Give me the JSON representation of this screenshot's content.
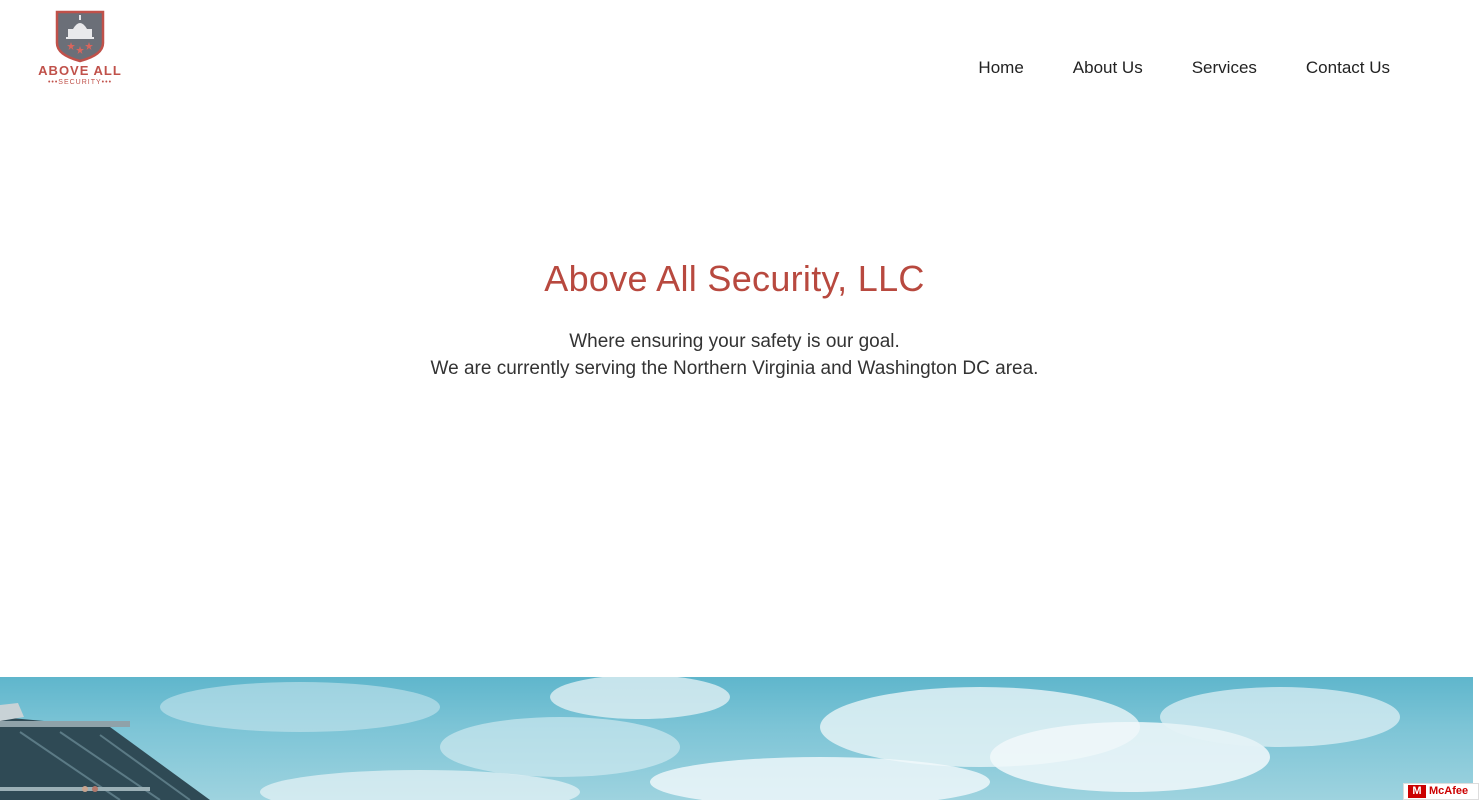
{
  "brand": {
    "name": "ABOVE ALL",
    "sub": "•••SECURITY•••",
    "color": "#c0514a"
  },
  "nav": {
    "items": [
      {
        "label": "Home"
      },
      {
        "label": "About Us"
      },
      {
        "label": "Services"
      },
      {
        "label": "Contact Us"
      }
    ]
  },
  "hero": {
    "title": "Above All Security, LLC",
    "line1": "Where ensuring your safety is our goal.",
    "line2": "We are currently serving the Northern Virginia and Washington DC area."
  },
  "badge": {
    "mark": "M",
    "label": "McAfee"
  },
  "colors": {
    "accent": "#b8493f",
    "text": "#333333",
    "sky": "#7cc4d6"
  }
}
